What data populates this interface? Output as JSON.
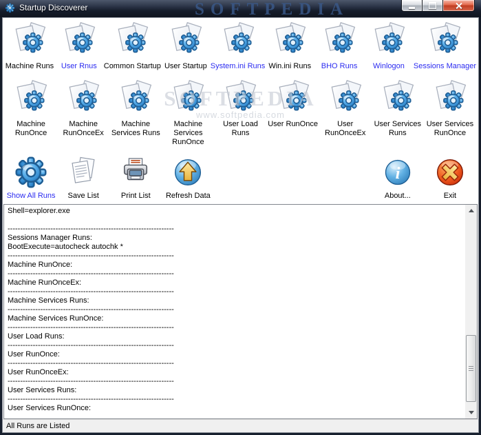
{
  "window": {
    "title": "Startup Discoverer",
    "titlebar_watermark": "SOFTPEDIA",
    "center_watermark": "SOFTPEDIA",
    "center_watermark_sub": "www.softpedia.com"
  },
  "colors": {
    "link_blue": "#2b2bf0",
    "label_black": "#000000",
    "gear_blue": "#2f8fd9",
    "close_red": "#bf3c20"
  },
  "toolbar": {
    "row1": [
      {
        "label": "Machine Runs",
        "icon": "doc-gear",
        "blue": false
      },
      {
        "label": "User Rnus",
        "icon": "doc-gear",
        "blue": true
      },
      {
        "label": "Common Startup",
        "icon": "doc-gear",
        "blue": false
      },
      {
        "label": "User Startup",
        "icon": "doc-gear",
        "blue": false
      },
      {
        "label": "System.ini Runs",
        "icon": "doc-gear",
        "blue": true
      },
      {
        "label": "Win.ini Runs",
        "icon": "doc-gear",
        "blue": false
      },
      {
        "label": "BHO Runs",
        "icon": "doc-gear",
        "blue": true
      },
      {
        "label": "Winlogon",
        "icon": "doc-gear",
        "blue": true
      },
      {
        "label": "Sessions Manager",
        "icon": "doc-gear",
        "blue": true
      }
    ],
    "row2": [
      {
        "label": "Machine RunOnce",
        "icon": "doc-gear",
        "blue": false
      },
      {
        "label": "Machine RunOnceEx",
        "icon": "doc-gear",
        "blue": false
      },
      {
        "label": "Machine Services Runs",
        "icon": "doc-gear",
        "blue": false
      },
      {
        "label": "Machine Services RunOnce",
        "icon": "doc-gear",
        "blue": false
      },
      {
        "label": "User Load Runs",
        "icon": "doc-gear",
        "blue": false
      },
      {
        "label": "User RunOnce",
        "icon": "doc-gear",
        "blue": false
      },
      {
        "label": "User RunOnceEx",
        "icon": "doc-gear",
        "blue": false
      },
      {
        "label": "User Services Runs",
        "icon": "doc-gear",
        "blue": false
      },
      {
        "label": "User Services RunOnce",
        "icon": "doc-gear",
        "blue": false
      }
    ],
    "row3": [
      {
        "label": "Show All Runs",
        "icon": "gear",
        "blue": true,
        "col": 1
      },
      {
        "label": "Save List",
        "icon": "save",
        "blue": false,
        "col": 2
      },
      {
        "label": "Print List",
        "icon": "print",
        "blue": false,
        "col": 3
      },
      {
        "label": "Refresh Data",
        "icon": "refresh",
        "blue": false,
        "col": 4
      },
      {
        "label": "About...",
        "icon": "about",
        "blue": false,
        "col": 8
      },
      {
        "label": "Exit",
        "icon": "exit",
        "blue": false,
        "col": 9
      }
    ]
  },
  "output": {
    "lines": [
      "Shell=explorer.exe",
      "",
      "------------------------------------------------------------------",
      "Sessions Manager Runs:",
      "BootExecute=autocheck autochk *",
      "------------------------------------------------------------------",
      "Machine RunOnce:",
      "------------------------------------------------------------------",
      "Machine RunOnceEx:",
      "------------------------------------------------------------------",
      "Machine Services Runs:",
      "------------------------------------------------------------------",
      "Machine Services RunOnce:",
      "------------------------------------------------------------------",
      "User Load Runs:",
      "------------------------------------------------------------------",
      "User RunOnce:",
      "------------------------------------------------------------------",
      "User RunOnceEx:",
      "------------------------------------------------------------------",
      "User Services Runs:",
      "------------------------------------------------------------------",
      "User Services RunOnce:"
    ]
  },
  "statusbar": {
    "text": "All Runs are Listed"
  }
}
